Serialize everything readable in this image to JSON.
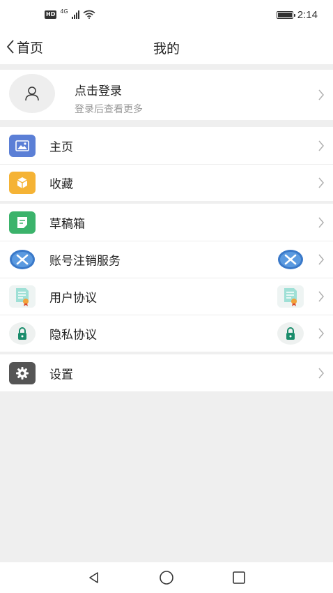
{
  "status_bar": {
    "hd_label": "HD",
    "network_label": "4G",
    "time": "2:14",
    "battery_level": 1.0
  },
  "nav": {
    "back_label": "首页",
    "title": "我的"
  },
  "login": {
    "title": "点击登录",
    "subtitle": "登录后查看更多"
  },
  "menu_groups": [
    {
      "items": [
        {
          "label": "主页",
          "icon": "image-icon",
          "icon_color": "#5b7fd6"
        },
        {
          "label": "收藏",
          "icon": "box-icon",
          "icon_color": "#f5b335"
        }
      ]
    },
    {
      "items": [
        {
          "label": "草稿箱",
          "icon": "document-icon",
          "icon_color": "#3bb36b"
        },
        {
          "label": "账号注销服务",
          "icon": "x-circle-icon",
          "icon_color": "#3a79c9"
        },
        {
          "label": "用户协议",
          "icon": "certificate-icon",
          "icon_color": "#7fd3c8"
        },
        {
          "label": "隐私协议",
          "icon": "lock-icon",
          "icon_color": "#1a8c6b"
        }
      ]
    },
    {
      "items": [
        {
          "label": "设置",
          "icon": "gear-icon",
          "icon_color": "#555555"
        }
      ]
    }
  ],
  "system_nav": {
    "buttons": [
      "back-triangle-icon",
      "home-circle-icon",
      "recents-square-icon"
    ]
  }
}
